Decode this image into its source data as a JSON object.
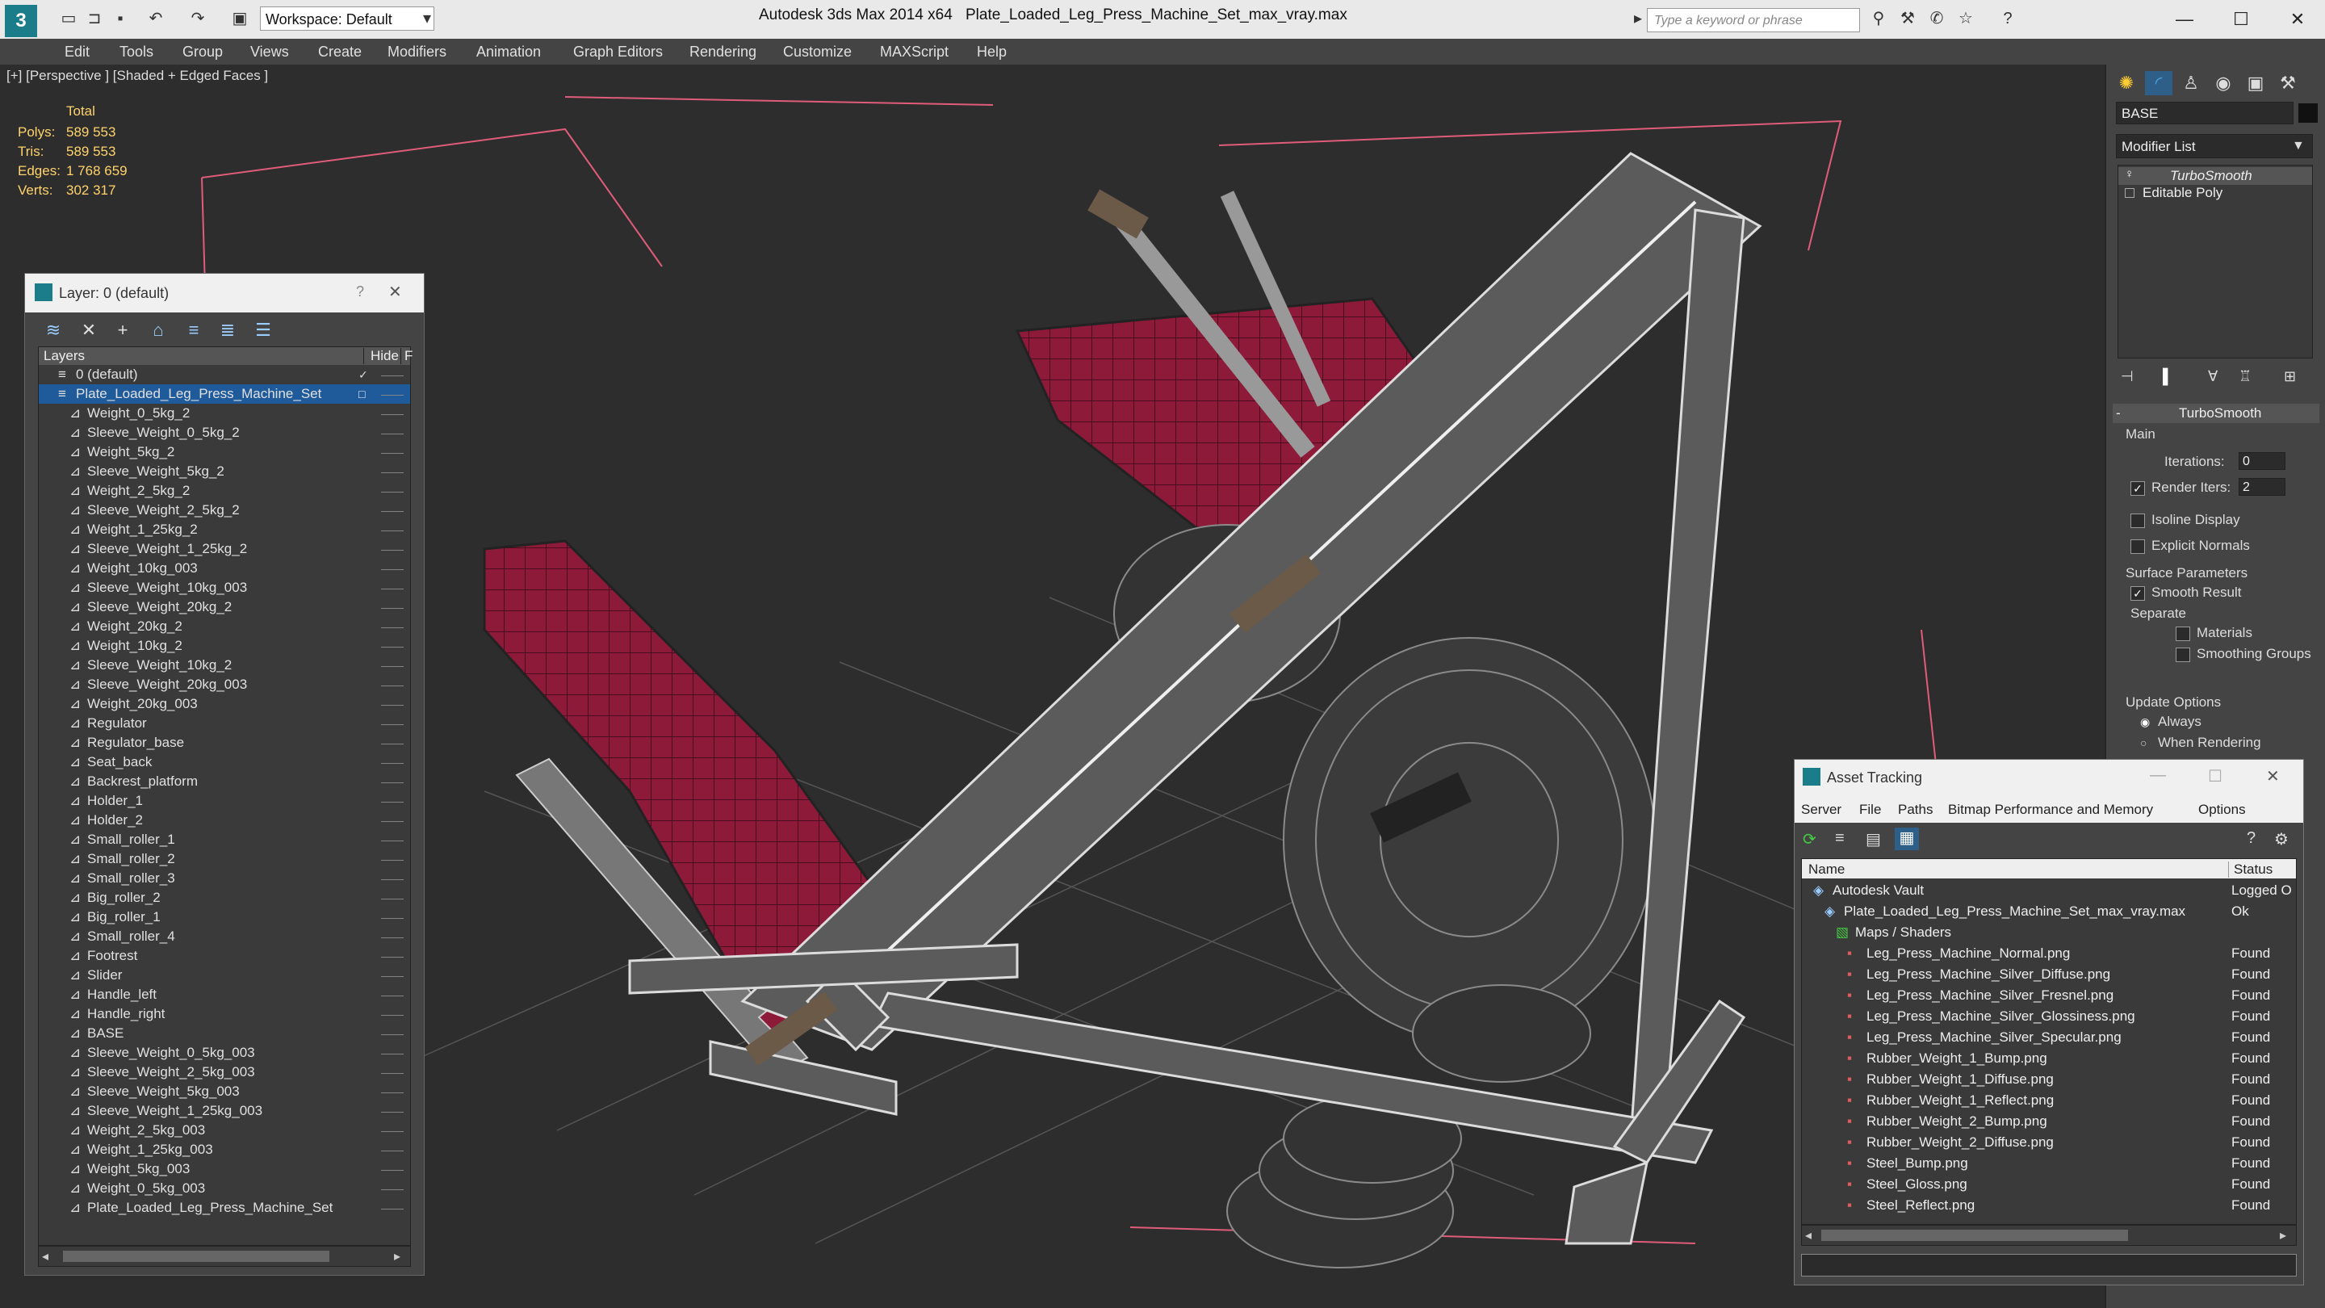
{
  "titlebar": {
    "workspace": "Workspace: Default",
    "app_title": "Autodesk 3ds Max  2014 x64",
    "file_title": "Plate_Loaded_Leg_Press_Machine_Set_max_vray.max",
    "search_placeholder": "Type a keyword or phrase"
  },
  "menu": [
    "Edit",
    "Tools",
    "Group",
    "Views",
    "Create",
    "Modifiers",
    "Animation",
    "Graph Editors",
    "Rendering",
    "Customize",
    "MAXScript",
    "Help"
  ],
  "viewport": {
    "label": "[+] [Perspective ] [Shaded + Edged Faces ]",
    "stats": {
      "total": "Total",
      "rows": [
        {
          "k": "Polys:",
          "v": "589 553"
        },
        {
          "k": "Tris:",
          "v": "589 553"
        },
        {
          "k": "Edges:",
          "v": "1 768 659"
        },
        {
          "k": "Verts:",
          "v": "302 317"
        }
      ]
    }
  },
  "layer_panel": {
    "title": "Layer: 0 (default)",
    "help": "?",
    "close": "✕",
    "col_layers": "Layers",
    "col_hide": "Hide",
    "col_f": "F",
    "root_layers": [
      {
        "name": "0 (default)"
      },
      {
        "name": "Plate_Loaded_Leg_Press_Machine_Set"
      }
    ],
    "objects": [
      "Weight_0_5kg_2",
      "Sleeve_Weight_0_5kg_2",
      "Weight_5kg_2",
      "Sleeve_Weight_5kg_2",
      "Weight_2_5kg_2",
      "Sleeve_Weight_2_5kg_2",
      "Weight_1_25kg_2",
      "Sleeve_Weight_1_25kg_2",
      "Weight_10kg_003",
      "Sleeve_Weight_10kg_003",
      "Sleeve_Weight_20kg_2",
      "Weight_20kg_2",
      "Weight_10kg_2",
      "Sleeve_Weight_10kg_2",
      "Sleeve_Weight_20kg_003",
      "Weight_20kg_003",
      "Regulator",
      "Regulator_base",
      "Seat_back",
      "Backrest_platform",
      "Holder_1",
      "Holder_2",
      "Small_roller_1",
      "Small_roller_2",
      "Small_roller_3",
      "Big_roller_2",
      "Big_roller_1",
      "Small_roller_4",
      "Footrest",
      "Slider",
      "Handle_left",
      "Handle_right",
      "BASE",
      "Sleeve_Weight_0_5kg_003",
      "Sleeve_Weight_2_5kg_003",
      "Sleeve_Weight_5kg_003",
      "Sleeve_Weight_1_25kg_003",
      "Weight_2_5kg_003",
      "Weight_1_25kg_003",
      "Weight_5kg_003",
      "Weight_0_5kg_003",
      "Plate_Loaded_Leg_Press_Machine_Set"
    ]
  },
  "command_panel": {
    "object_name": "BASE",
    "modifier_list": "Modifier List",
    "stack": [
      "TurboSmooth",
      "Editable Poly"
    ],
    "rollout_title": "TurboSmooth",
    "main": "Main",
    "iterations_label": "Iterations:",
    "iterations_value": "0",
    "render_iters_label": "Render Iters:",
    "render_iters_value": "2",
    "isoline": "Isoline Display",
    "explicit_normals": "Explicit Normals",
    "surface_params": "Surface Parameters",
    "smooth_result": "Smooth Result",
    "separate": "Separate",
    "materials": "Materials",
    "smoothing_groups": "Smoothing Groups",
    "update_options": "Update Options",
    "always": "Always",
    "when_rendering": "When Rendering"
  },
  "asset_tracking": {
    "title": "Asset Tracking",
    "menu": [
      "Server",
      "File",
      "Paths",
      "Bitmap Performance and Memory",
      "Options"
    ],
    "col_name": "Name",
    "col_status": "Status",
    "rows": [
      {
        "name": "Autodesk Vault",
        "status": "Logged O",
        "indent": 0
      },
      {
        "name": "Plate_Loaded_Leg_Press_Machine_Set_max_vray.max",
        "status": "Ok",
        "indent": 1
      },
      {
        "name": "Maps / Shaders",
        "status": "",
        "indent": 2
      },
      {
        "name": "Leg_Press_Machine_Normal.png",
        "status": "Found",
        "indent": 3
      },
      {
        "name": "Leg_Press_Machine_Silver_Diffuse.png",
        "status": "Found",
        "indent": 3
      },
      {
        "name": "Leg_Press_Machine_Silver_Fresnel.png",
        "status": "Found",
        "indent": 3
      },
      {
        "name": "Leg_Press_Machine_Silver_Glossiness.png",
        "status": "Found",
        "indent": 3
      },
      {
        "name": "Leg_Press_Machine_Silver_Specular.png",
        "status": "Found",
        "indent": 3
      },
      {
        "name": "Rubber_Weight_1_Bump.png",
        "status": "Found",
        "indent": 3
      },
      {
        "name": "Rubber_Weight_1_Diffuse.png",
        "status": "Found",
        "indent": 3
      },
      {
        "name": "Rubber_Weight_1_Reflect.png",
        "status": "Found",
        "indent": 3
      },
      {
        "name": "Rubber_Weight_2_Bump.png",
        "status": "Found",
        "indent": 3
      },
      {
        "name": "Rubber_Weight_2_Diffuse.png",
        "status": "Found",
        "indent": 3
      },
      {
        "name": "Steel_Bump.png",
        "status": "Found",
        "indent": 3
      },
      {
        "name": "Steel_Gloss.png",
        "status": "Found",
        "indent": 3
      },
      {
        "name": "Steel_Reflect.png",
        "status": "Found",
        "indent": 3
      }
    ]
  }
}
